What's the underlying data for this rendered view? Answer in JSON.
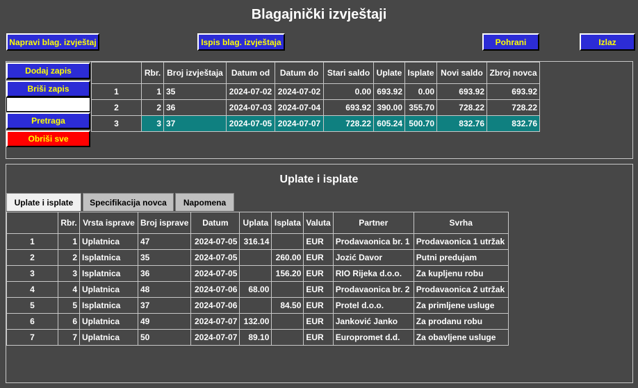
{
  "title": "Blagajnički izvještaji",
  "top_buttons": {
    "make_report": "Napravi blag. izvještaj",
    "print_report": "Ispis blag. izvještaja",
    "save": "Pohrani",
    "exit": "Izlaz"
  },
  "side_buttons": {
    "add_record": "Dodaj zapis",
    "delete_record": "Briši zapis",
    "search": "Pretraga",
    "clear_all": "Obriši sve"
  },
  "colors": {
    "background": "#474747",
    "button": "#2c2cd6",
    "button_text": "#ffff00",
    "danger": "#ff0000",
    "selected_row": "#0f8080"
  },
  "reports": {
    "columns": [
      "",
      "Rbr.",
      "Broj izvještaja",
      "Datum od",
      "Datum do",
      "Stari saldo",
      "Uplate",
      "Isplate",
      "Novi saldo",
      "Zbroj novca"
    ],
    "rows": [
      [
        "1",
        "1",
        "35",
        "2024-07-02",
        "2024-07-02",
        "0.00",
        "693.92",
        "0.00",
        "693.92",
        "693.92"
      ],
      [
        "2",
        "2",
        "36",
        "2024-07-03",
        "2024-07-04",
        "693.92",
        "390.00",
        "355.70",
        "728.22",
        "728.22"
      ],
      [
        "3",
        "3",
        "37",
        "2024-07-05",
        "2024-07-07",
        "728.22",
        "605.24",
        "500.70",
        "832.76",
        "832.76"
      ]
    ],
    "selected_row": 2
  },
  "section_title": "Uplate i isplate",
  "tabs": [
    "Uplate i isplate",
    "Specifikacija novca",
    "Napomena"
  ],
  "active_tab": 0,
  "transactions": {
    "columns": [
      "",
      "Rbr.",
      "Vrsta isprave",
      "Broj isprave",
      "Datum",
      "Uplata",
      "Isplata",
      "Valuta",
      "Partner",
      "Svrha"
    ],
    "rows": [
      [
        "1",
        "1",
        "Uplatnica",
        "47",
        "2024-07-05",
        "316.14",
        "",
        "EUR",
        "Prodavaonica br. 1",
        "Prodavaonica 1 utržak"
      ],
      [
        "2",
        "2",
        "Isplatnica",
        "35",
        "2024-07-05",
        "",
        "260.00",
        "EUR",
        "Jozić Davor",
        "Putni predujam"
      ],
      [
        "3",
        "3",
        "Isplatnica",
        "36",
        "2024-07-05",
        "",
        "156.20",
        "EUR",
        "RIO Rijeka d.o.o.",
        "Za kupljenu robu"
      ],
      [
        "4",
        "4",
        "Uplatnica",
        "48",
        "2024-07-06",
        "68.00",
        "",
        "EUR",
        "Prodavaonica br. 2",
        "Prodavaonica 2 utržak"
      ],
      [
        "5",
        "5",
        "Isplatnica",
        "37",
        "2024-07-06",
        "",
        "84.50",
        "EUR",
        "Protel d.o.o.",
        "Za primljene usluge"
      ],
      [
        "6",
        "6",
        "Uplatnica",
        "49",
        "2024-07-07",
        "132.00",
        "",
        "EUR",
        "Janković Janko",
        "Za prodanu robu"
      ],
      [
        "7",
        "7",
        "Uplatnica",
        "50",
        "2024-07-07",
        "89.10",
        "",
        "EUR",
        "Europromet d.d.",
        "Za obavljene usluge"
      ]
    ]
  }
}
